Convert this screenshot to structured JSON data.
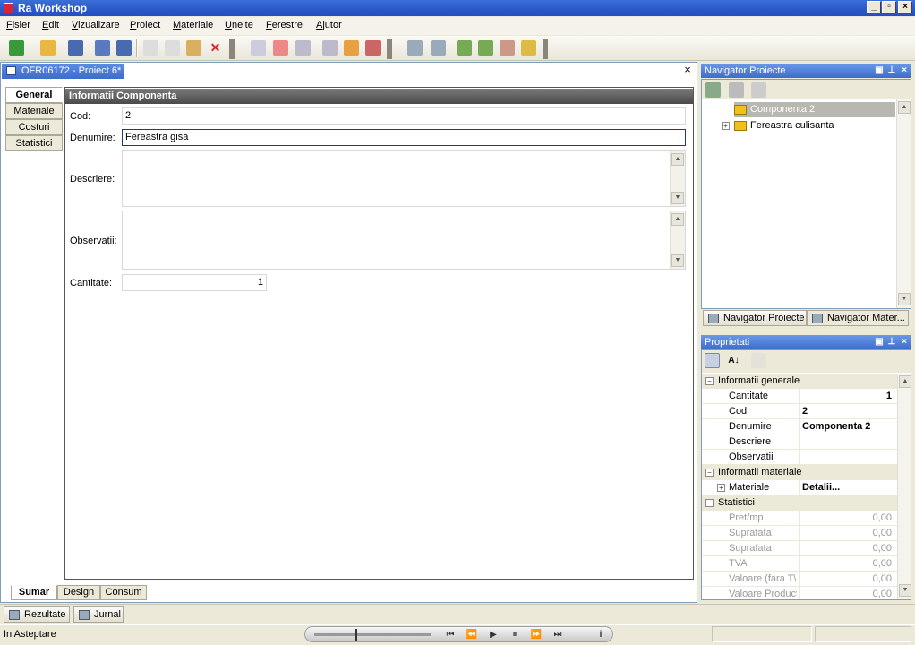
{
  "window": {
    "title": "Ra Workshop",
    "buttons": [
      "_",
      "▫",
      "×"
    ]
  },
  "menu": [
    "Fisier",
    "Edit",
    "Vizualizare",
    "Proiect",
    "Materiale",
    "Unelte",
    "Ferestre",
    "Ajutor"
  ],
  "document": {
    "tab_title": "OFR06172 - Proiect 6*",
    "close_glyph": "×",
    "side_tabs": [
      "General",
      "Materiale",
      "Costuri",
      "Statistici"
    ],
    "section_title": "Informatii Componenta",
    "fields": {
      "cod_label": "Cod:",
      "cod_value": "2",
      "denumire_label": "Denumire:",
      "denumire_value": "Fereastra gisa",
      "descriere_label": "Descriere:",
      "observatii_label": "Observatii:",
      "cantitate_label": "Cantitate:",
      "cantitate_value": "1"
    },
    "bottom_tabs": [
      "Sumar",
      "Design",
      "Consum"
    ]
  },
  "navigator": {
    "title": "Navigator Proiecte",
    "tree": [
      {
        "label": "Componenta 2",
        "selected": true
      },
      {
        "label": "Fereastra culisanta",
        "selected": false
      }
    ],
    "tabs": [
      "Navigator Proiecte",
      "Navigator Mater..."
    ]
  },
  "properties": {
    "title": "Proprietati",
    "categories": [
      {
        "name": "Informatii generale",
        "rows": [
          {
            "key": "Cantitate",
            "value": "1",
            "align": "right"
          },
          {
            "key": "Cod",
            "value": "2",
            "align": "left"
          },
          {
            "key": "Denumire",
            "value": "Componenta 2",
            "align": "left"
          },
          {
            "key": "Descriere",
            "value": "",
            "align": "left"
          },
          {
            "key": "Observatii",
            "value": "",
            "align": "left"
          }
        ]
      },
      {
        "name": "Informatii materiale",
        "rows": [
          {
            "key": "Materiale",
            "value": "Detalii...",
            "align": "left"
          }
        ]
      },
      {
        "name": "Statistici",
        "rows": [
          {
            "key": "Pret/mp",
            "value": "0,00"
          },
          {
            "key": "Suprafata",
            "value": "0,00"
          },
          {
            "key": "Suprafata",
            "value": "0,00"
          },
          {
            "key": "TVA",
            "value": "0,00"
          },
          {
            "key": "Valoare (fara T\\",
            "value": "0,00"
          },
          {
            "key": "Valoare Product",
            "value": "0,00"
          }
        ]
      }
    ]
  },
  "output_tabs": [
    "Rezultate",
    "Jurnal"
  ],
  "status": {
    "text": "In Asteptare"
  },
  "player_buttons": [
    "⏮",
    "⏪",
    "▶",
    "⏸",
    "⏩",
    "⏭"
  ],
  "colors": {
    "accent": "#3c6dcc",
    "chrome": "#ece9d8"
  }
}
